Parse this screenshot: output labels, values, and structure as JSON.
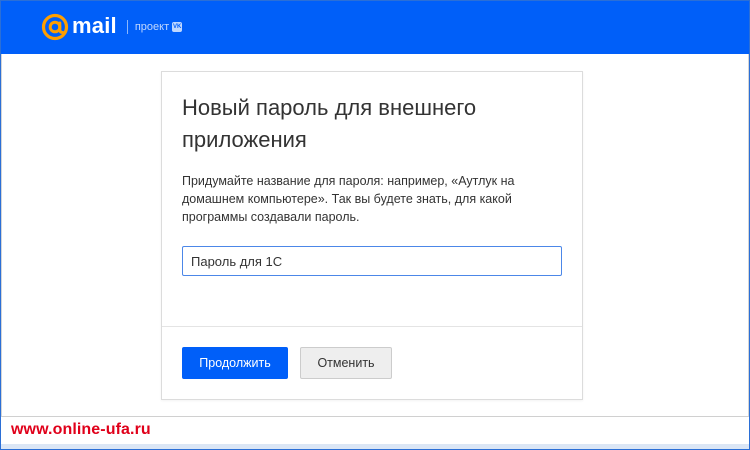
{
  "colors": {
    "brand": "#005ff9",
    "watermark": "#e0001a"
  },
  "header": {
    "logo_icon": "at-sign-icon",
    "logo_text": "mail",
    "project_text": "проект",
    "vk_badge": "vk"
  },
  "dialog": {
    "title": "Новый пароль для внешнего приложения",
    "description": "Придумайте название для пароля: например, «Аутлук на домашнем компьютере». Так вы будете знать, для какой программы создавали пароль.",
    "input_value": "Пароль для 1С",
    "continue_label": "Продолжить",
    "cancel_label": "Отменить"
  },
  "watermark": "www.online-ufa.ru"
}
